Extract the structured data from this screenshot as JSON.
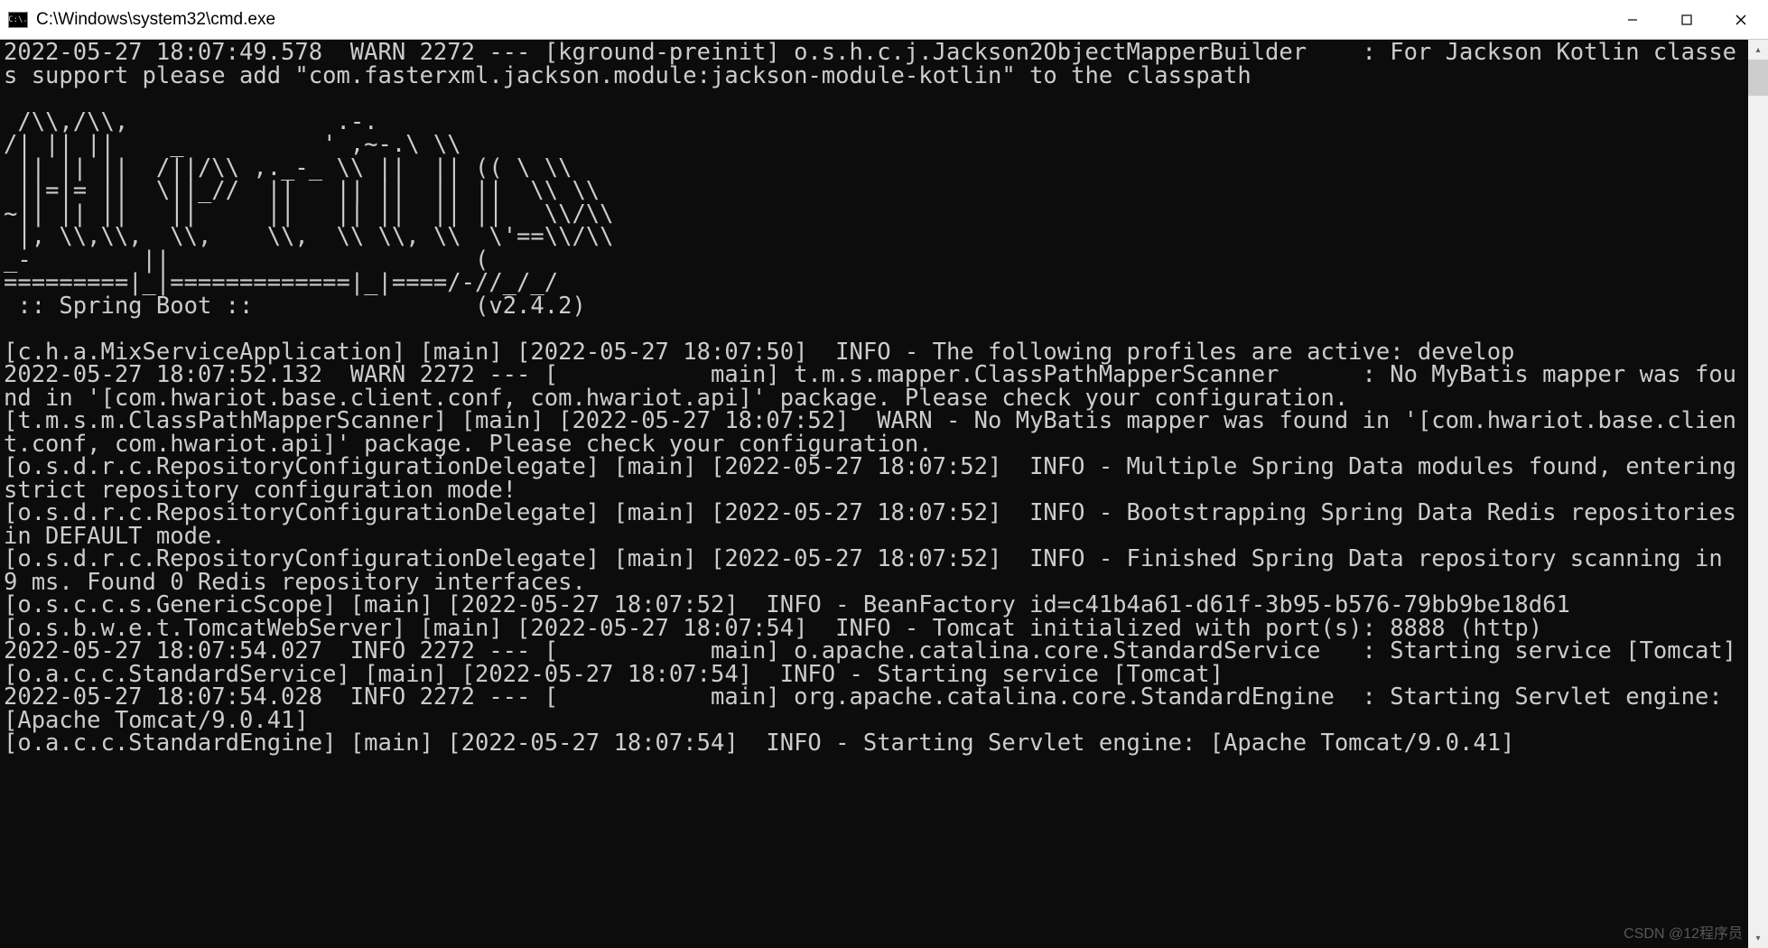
{
  "window": {
    "title": "C:\\Windows\\system32\\cmd.exe",
    "icon_label": "C:\\."
  },
  "console": {
    "lines": [
      "2022-05-27 18:07:49.578  WARN 2272 --- [kground-preinit] o.s.h.c.j.Jackson2ObjectMapperBuilder    : For Jackson Kotlin classes support please add \"com.fasterxml.jackson.module:jackson-module-kotlin\" to the classpath",
      "",
      " /\\\\,/\\\\,               .-.",
      "/| || ||    _          ' ,~-.\\ \\\\",
      " || || ||  /||/\\\\ ,._-_ \\\\ ||  || (( \\ \\\\",
      " ||=|= ||  \\||_//  ||   || ||  || ||  \\\\ \\\\",
      "~|| || ||   ||     ||   || ||  || ||   \\\\/\\\\",
      " |, \\\\,\\\\,  \\\\,    \\\\,  \\\\ \\\\, \\\\  \\'==\\\\/\\\\",
      "_-        ||                      (            ",
      "=========|_|=============|_|====/-//_/_/",
      " :: Spring Boot ::                (v2.4.2)",
      "",
      "[c.h.a.MixServiceApplication] [main] [2022-05-27 18:07:50]  INFO - The following profiles are active: develop",
      "2022-05-27 18:07:52.132  WARN 2272 --- [           main] t.m.s.mapper.ClassPathMapperScanner      : No MyBatis mapper was found in '[com.hwariot.base.client.conf, com.hwariot.api]' package. Please check your configuration.",
      "[t.m.s.m.ClassPathMapperScanner] [main] [2022-05-27 18:07:52]  WARN - No MyBatis mapper was found in '[com.hwariot.base.client.conf, com.hwariot.api]' package. Please check your configuration.",
      "[o.s.d.r.c.RepositoryConfigurationDelegate] [main] [2022-05-27 18:07:52]  INFO - Multiple Spring Data modules found, entering strict repository configuration mode!",
      "[o.s.d.r.c.RepositoryConfigurationDelegate] [main] [2022-05-27 18:07:52]  INFO - Bootstrapping Spring Data Redis repositories in DEFAULT mode.",
      "[o.s.d.r.c.RepositoryConfigurationDelegate] [main] [2022-05-27 18:07:52]  INFO - Finished Spring Data repository scanning in 9 ms. Found 0 Redis repository interfaces.",
      "[o.s.c.c.s.GenericScope] [main] [2022-05-27 18:07:52]  INFO - BeanFactory id=c41b4a61-d61f-3b95-b576-79bb9be18d61",
      "[o.s.b.w.e.t.TomcatWebServer] [main] [2022-05-27 18:07:54]  INFO - Tomcat initialized with port(s): 8888 (http)",
      "2022-05-27 18:07:54.027  INFO 2272 --- [           main] o.apache.catalina.core.StandardService   : Starting service [Tomcat]",
      "[o.a.c.c.StandardService] [main] [2022-05-27 18:07:54]  INFO - Starting service [Tomcat]",
      "2022-05-27 18:07:54.028  INFO 2272 --- [           main] org.apache.catalina.core.StandardEngine  : Starting Servlet engine: [Apache Tomcat/9.0.41]",
      "[o.a.c.c.StandardEngine] [main] [2022-05-27 18:07:54]  INFO - Starting Servlet engine: [Apache Tomcat/9.0.41]"
    ]
  },
  "watermark": "CSDN @12程序员"
}
